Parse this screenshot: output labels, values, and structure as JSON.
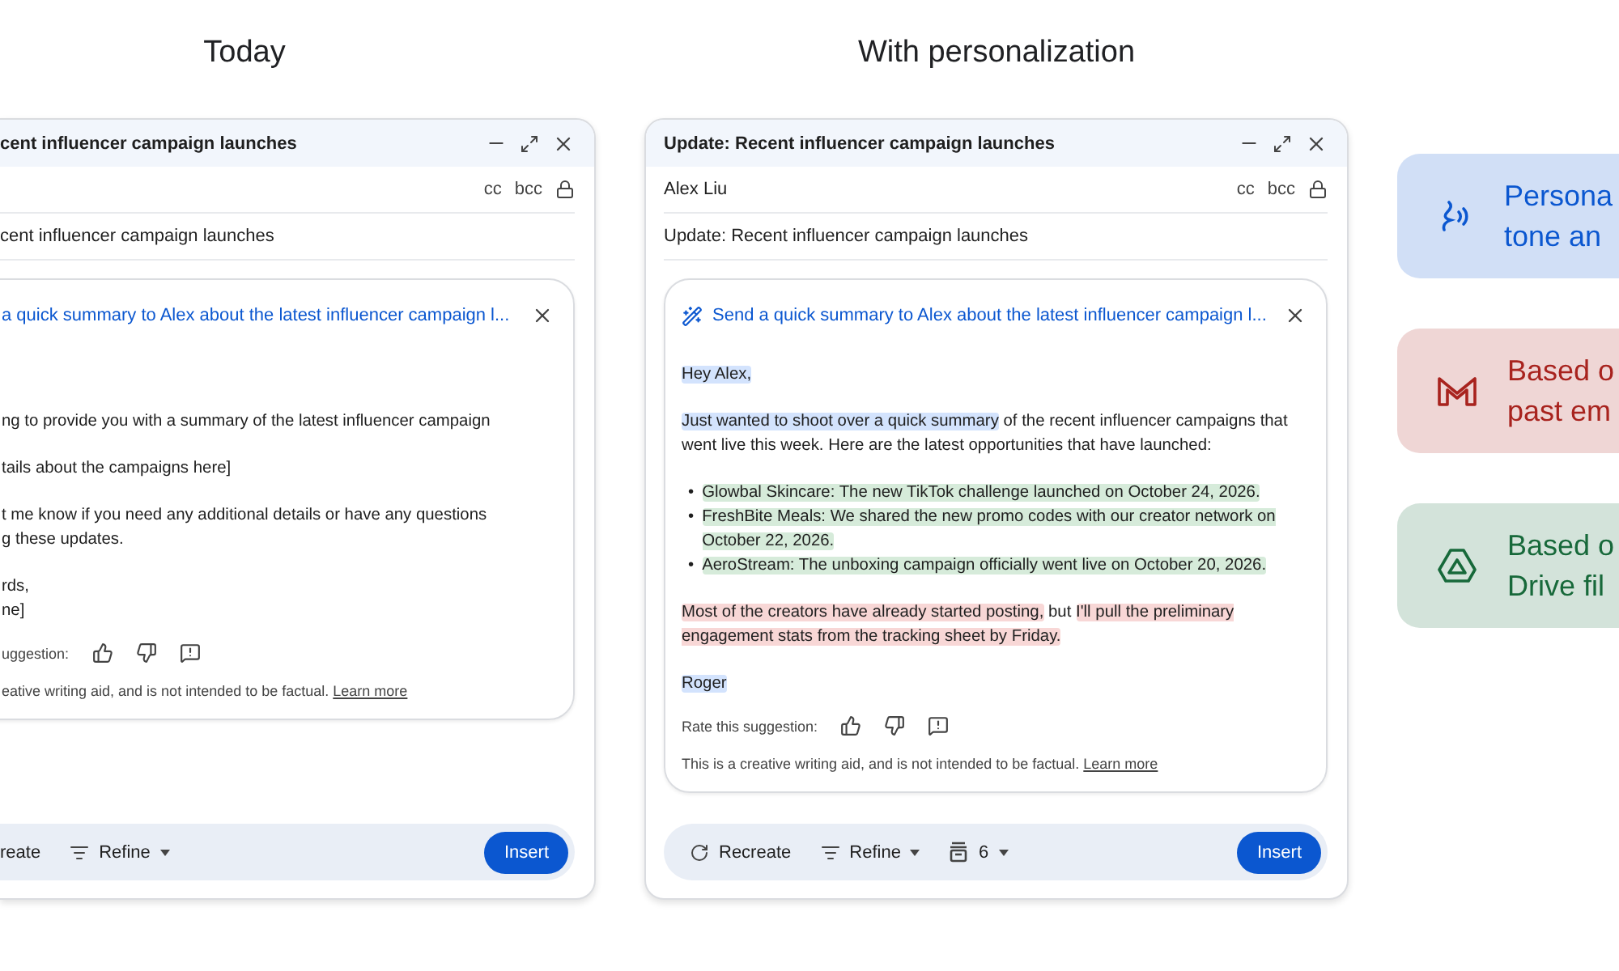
{
  "panels": [
    {
      "heading": "Today",
      "compose": {
        "title": "cent influencer campaign launches",
        "cc": "cc",
        "bcc": "bcc",
        "subject": "cent influencer campaign launches",
        "prompt": "a quick summary to Alex about the latest influencer campaign l...",
        "prompt_icon": false,
        "body": [
          {
            "kind": "lines",
            "lines": [
              "ng to provide you with a summary of the latest influencer campaign"
            ]
          },
          {
            "kind": "lines",
            "lines": [
              "tails about the campaigns here]"
            ]
          },
          {
            "kind": "lines",
            "lines": [
              "t me know if you need any additional details or have any questions",
              "g these updates."
            ]
          },
          {
            "kind": "lines",
            "lines": [
              "rds,",
              "ne]"
            ]
          }
        ],
        "rate_label": "uggestion:",
        "disclaimer": "eative writing aid, and is not intended to be factual.",
        "link": "Learn more",
        "actions": [
          {
            "kind": "recreate",
            "label": "reate",
            "icon": false
          },
          {
            "kind": "refine",
            "label": "Refine",
            "icon": true
          }
        ],
        "insert": "Insert"
      }
    },
    {
      "heading": "With personalization",
      "compose": {
        "title": "Update: Recent influencer campaign launches",
        "to": "Alex Liu",
        "cc": "cc",
        "bcc": "bcc",
        "subject": "Update: Recent influencer campaign launches",
        "prompt": "Send a quick summary to Alex about the latest influencer campaign l...",
        "prompt_icon": true,
        "body": [
          {
            "kind": "paragraph",
            "segments": [
              {
                "text": "Hey Alex,",
                "color": "#d3e3fd"
              }
            ]
          },
          {
            "kind": "paragraph",
            "segments": [
              {
                "text": "Just wanted to shoot over a quick summary",
                "color": "#d3e3fd"
              },
              {
                "text": " of the recent influencer campaigns that went live this week. Here are the latest opportunities that have launched:"
              }
            ]
          },
          {
            "kind": "list",
            "items": [
              {
                "marker": "•",
                "segments": [
                  {
                    "text": "Glowbal Skincare: The new TikTok challenge launched on October 24, 2026.",
                    "color": "#d6ebda"
                  }
                ]
              },
              {
                "marker": "•",
                "segments": [
                  {
                    "text": "FreshBite Meals: We shared the new promo codes with our creator network on October 22, 2026.",
                    "color": "#d6ebda"
                  }
                ]
              },
              {
                "marker": "•",
                "segments": [
                  {
                    "text": "AeroStream: The unboxing campaign officially went live on October 20, 2026.",
                    "color": "#d6ebda"
                  }
                ]
              }
            ]
          },
          {
            "kind": "paragraph",
            "segments": [
              {
                "text": "Most of the creators have already started posting,",
                "color": "#f8d7d6"
              },
              {
                "text": " but "
              },
              {
                "text": "I'll pull the preliminary engagement stats from the tracking sheet by Friday.",
                "color": "#f8d7d6"
              }
            ]
          },
          {
            "kind": "paragraph",
            "segments": [
              {
                "text": "Roger",
                "color": "#d3e3fd"
              }
            ]
          }
        ],
        "rate_label": "Rate this suggestion:",
        "disclaimer": "This is a creative writing aid, and is not intended to be factual.",
        "link": "Learn more",
        "actions": [
          {
            "kind": "recreate",
            "label": "Recreate",
            "icon": true
          },
          {
            "kind": "refine",
            "label": "Refine",
            "icon": true
          },
          {
            "kind": "length",
            "label": "6",
            "icon": true
          }
        ],
        "insert": "Insert"
      }
    }
  ],
  "sources": [
    {
      "kind": "tone",
      "lines": [
        "Persona",
        "tone an"
      ],
      "color": "#0b57d0"
    },
    {
      "kind": "email",
      "lines": [
        "Based o",
        "past em"
      ],
      "color": "#a8231e"
    },
    {
      "kind": "drive",
      "lines": [
        "Based o",
        "Drive fil"
      ],
      "color": "#17693a"
    }
  ]
}
